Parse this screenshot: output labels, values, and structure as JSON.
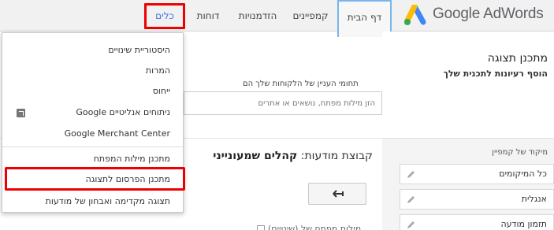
{
  "logo": {
    "text": "Google AdWords"
  },
  "nav": {
    "home": "דף הבית",
    "campaigns": "קמפיינים",
    "opportunities": "הזדמנויות",
    "reports": "דוחות",
    "tools": "כלים"
  },
  "tools_menu": {
    "items": [
      "היסטוריית שינויים",
      "המרות",
      "ייחוס",
      "Google ניתוחים אנליטיים",
      "Google Merchant Center",
      "מתכנן מילות המפתח",
      "מתכנן הפרסום לתצוגה",
      "תצוגה מקדימה ואבחון של מודעות"
    ]
  },
  "planner": {
    "title": "מתכנן תצוגה",
    "subtitle": "הוסף רעיונות לתכנית שלך",
    "interest_label": "תחומי העניין של הלקוחות שלך הם",
    "interest_placeholder": "הזן מילות מפתח, נושאים או אתרים",
    "targeting_label": "מיקוד של קמפיין",
    "chips": [
      "כל המיקומים",
      "אנגלית",
      "תזמון מודעה"
    ],
    "ad_group_prefix": "קבוצת מודעות:",
    "ad_group_name": "קהלים שמעונייני",
    "bottom_text": "מילות מפתח של (שינויים)"
  },
  "colors": {
    "accent": "#3b78e7",
    "highlight": "#ee0000",
    "home_tab_border": "#79b5ea"
  }
}
